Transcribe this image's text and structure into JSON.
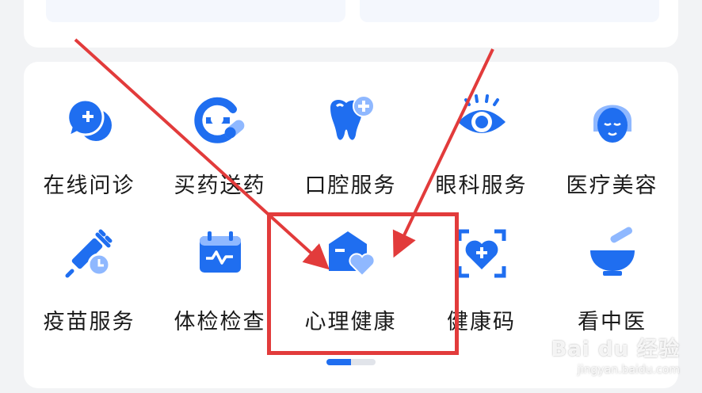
{
  "colors": {
    "icon_blue": "#1f6ef0",
    "icon_light": "#8fb8ff",
    "annotation_red": "#e23b3b",
    "card_bg": "#ffffff",
    "page_bg": "#f2f3f5"
  },
  "services": [
    {
      "label": "在线问诊",
      "icon": "chat-plus-icon"
    },
    {
      "label": "买药送药",
      "icon": "pill-e-icon"
    },
    {
      "label": "口腔服务",
      "icon": "tooth-plus-icon"
    },
    {
      "label": "眼科服务",
      "icon": "eye-icon"
    },
    {
      "label": "医疗美容",
      "icon": "face-icon"
    },
    {
      "label": "疫苗服务",
      "icon": "syringe-clock-icon"
    },
    {
      "label": "体检检查",
      "icon": "calendar-pulse-icon"
    },
    {
      "label": "心理健康",
      "icon": "house-heart-icon"
    },
    {
      "label": "健康码",
      "icon": "scan-heart-icon"
    },
    {
      "label": "看中医",
      "icon": "mortar-icon"
    }
  ],
  "pager": {
    "pages": 2,
    "active": 1
  },
  "annotation": {
    "highlighted_item": "心理健康"
  },
  "watermark": {
    "logo": "Bai du 经验",
    "url": "jingyan.baidu.com"
  }
}
